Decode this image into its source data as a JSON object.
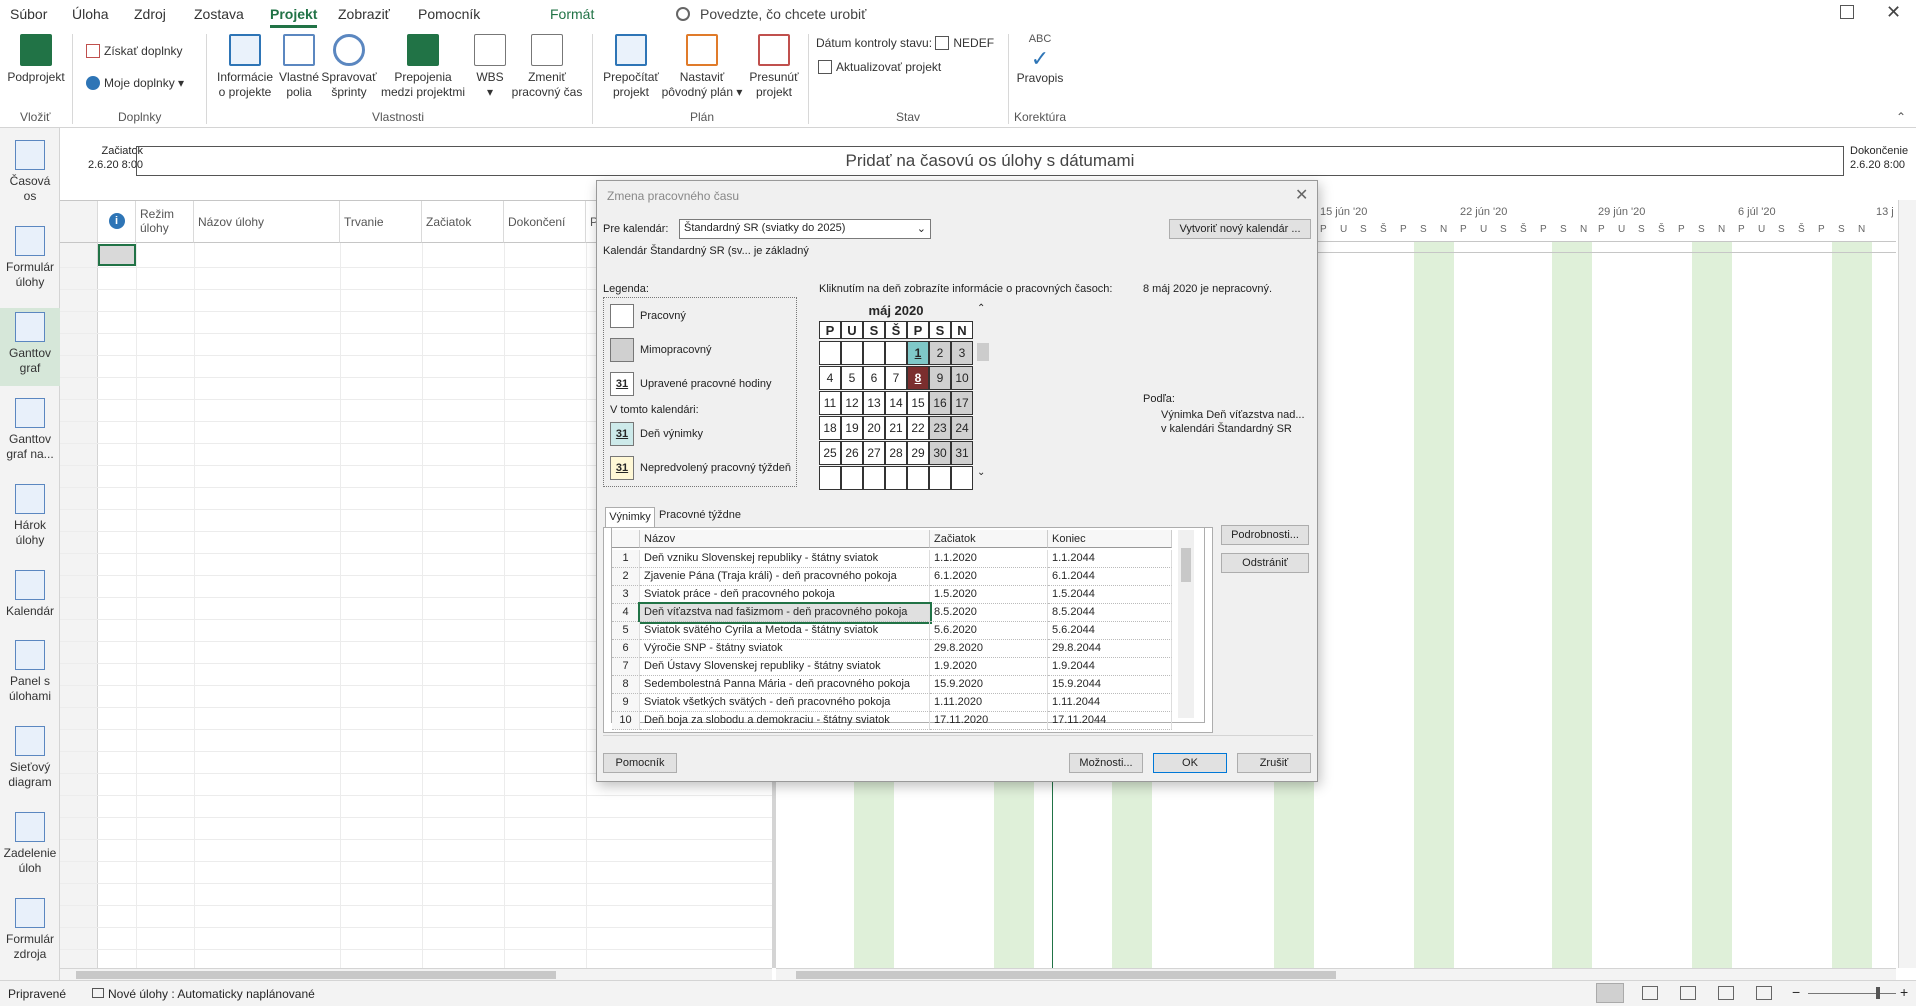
{
  "menu": {
    "items": [
      "Súbor",
      "Úloha",
      "Zdroj",
      "Zostava",
      "Projekt",
      "Zobraziť",
      "Pomocník",
      "Formát"
    ],
    "tellme": "Povedzte, čo chcete urobiť"
  },
  "ribbon": {
    "vlozit": {
      "podprojekt": "Podprojekt",
      "group": "Vložiť"
    },
    "doplnky": {
      "ziskat": "Získať doplnky",
      "moje": "Moje doplnky",
      "group": "Doplnky"
    },
    "vlastnosti": {
      "info1": "Informácie",
      "info2": "o projekte",
      "vlastne1": "Vlastné",
      "vlastne2": "polia",
      "sprav1": "Spravovať",
      "sprav2": "šprinty",
      "prep1": "Prepojenia",
      "prep2": "medzi projektmi",
      "wbs": "WBS",
      "zmen1": "Zmeniť",
      "zmen2": "pracovný čas",
      "group": "Vlastnosti"
    },
    "plan": {
      "prep1": "Prepočítať",
      "prep2": "projekt",
      "nast1": "Nastaviť",
      "nast2": "pôvodný plán",
      "pres1": "Presunúť",
      "pres2": "projekt",
      "group": "Plán"
    },
    "stav": {
      "datum_label": "Dátum kontroly stavu:",
      "datum_value": "NEDEF",
      "aktualizovat": "Aktualizovať projekt",
      "group": "Stav"
    },
    "korektura": {
      "abc": "ABC",
      "pravopis": "Pravopis",
      "group": "Korektúra"
    }
  },
  "viewbar": [
    {
      "l1": "Časová",
      "l2": "os"
    },
    {
      "l1": "Formulár",
      "l2": "úlohy"
    },
    {
      "l1": "Ganttov",
      "l2": "graf"
    },
    {
      "l1": "Ganttov",
      "l2": "graf na..."
    },
    {
      "l1": "Hárok",
      "l2": "úlohy"
    },
    {
      "l1": "Kalendár",
      "l2": ""
    },
    {
      "l1": "Panel s",
      "l2": "úlohami"
    },
    {
      "l1": "Sieťový",
      "l2": "diagram"
    },
    {
      "l1": "Zadelenie",
      "l2": "úloh"
    },
    {
      "l1": "Formulár",
      "l2": "zdroja"
    }
  ],
  "timeline": {
    "start_label": "Začiatok",
    "start_value": "2.6.20 8:00",
    "end_label": "Dokončenie",
    "end_value": "2.6.20 8:00",
    "placeholder": "Pridať na časovú os úlohy s dátumami"
  },
  "grid": {
    "info_icon": "i",
    "columns": [
      "Režim úlohy",
      "Názov úlohy",
      "Trvanie",
      "Začiatok",
      "Dokončení",
      "P"
    ]
  },
  "gantt": {
    "weeks": [
      "15 jún '20",
      "22 jún '20",
      "29 jún '20",
      "6 júl '20",
      "13 j"
    ],
    "days": [
      "P",
      "U",
      "S",
      "Š",
      "P",
      "S",
      "N"
    ]
  },
  "status": {
    "ready": "Pripravené",
    "new_tasks": "Nové úlohy : Automaticky naplánované"
  },
  "dialog": {
    "title": "Zmena pracovného času",
    "pre_kalendar_label": "Pre kalendár:",
    "pre_kalendar_value": "Štandardný SR (sviatky do 2025)",
    "base_note": "Kalendár Štandardný SR (sv... je základný",
    "new_calendar_btn": "Vytvoriť nový kalendár ...",
    "legend_title": "Legenda:",
    "legend_working": "Pracovný",
    "legend_nonworking": "Mimopracovný",
    "legend_edited": "Upravené pracovné hodiny",
    "legend_in_cal": "V tomto kalendári:",
    "legend_exception": "Deň výnimky",
    "legend_nondefault": "Nepredvolený pracovný týždeň",
    "legend_num": "31",
    "click_info": "Kliknutím na deň zobrazíte informácie o pracovných časoch:",
    "selected_info": "8 máj 2020 je nepracovný.",
    "based_on": "Podľa:",
    "based_line1": "Výnimka Deň víťazstva nad...",
    "based_line2": "v kalendári Štandardný SR",
    "month": "máj 2020",
    "dow": [
      "P",
      "U",
      "S",
      "Š",
      "P",
      "S",
      "N"
    ],
    "weeks": [
      [
        "",
        "",
        "",
        "",
        "1",
        "2",
        "3"
      ],
      [
        "4",
        "5",
        "6",
        "7",
        "8",
        "9",
        "10"
      ],
      [
        "11",
        "12",
        "13",
        "14",
        "15",
        "16",
        "17"
      ],
      [
        "18",
        "19",
        "20",
        "21",
        "22",
        "23",
        "24"
      ],
      [
        "25",
        "26",
        "27",
        "28",
        "29",
        "30",
        "31"
      ],
      [
        "",
        "",
        "",
        "",
        "",
        "",
        ""
      ]
    ],
    "tab_exceptions": "Výnimky",
    "tab_weeks": "Pracovné týždne",
    "exc_headers": [
      "Názov",
      "Začiatok",
      "Koniec"
    ],
    "exc_rows": [
      {
        "n": "1",
        "name": "Deň vzniku Slovenskej republiky - štátny sviatok",
        "start": "1.1.2020",
        "end": "1.1.2044"
      },
      {
        "n": "2",
        "name": "Zjavenie Pána (Traja králi) - deň pracovného pokoja",
        "start": "6.1.2020",
        "end": "6.1.2044"
      },
      {
        "n": "3",
        "name": "Sviatok práce - deň pracovného pokoja",
        "start": "1.5.2020",
        "end": "1.5.2044"
      },
      {
        "n": "4",
        "name": "Deň víťazstva nad fašizmom - deň pracovného pokoja",
        "start": "8.5.2020",
        "end": "8.5.2044"
      },
      {
        "n": "5",
        "name": "Sviatok svätého Cyrila a Metoda - štátny sviatok",
        "start": "5.6.2020",
        "end": "5.6.2044"
      },
      {
        "n": "6",
        "name": "Výročie SNP - štátny sviatok",
        "start": "29.8.2020",
        "end": "29.8.2044"
      },
      {
        "n": "7",
        "name": "Deň Ústavy Slovenskej republiky - štátny sviatok",
        "start": "1.9.2020",
        "end": "1.9.2044"
      },
      {
        "n": "8",
        "name": "Sedembolestná Panna Mária - deň pracovného pokoja",
        "start": "15.9.2020",
        "end": "15.9.2044"
      },
      {
        "n": "9",
        "name": "Sviatok všetkých svätých - deň pracovného pokoja",
        "start": "1.11.2020",
        "end": "1.11.2044"
      },
      {
        "n": "10",
        "name": "Deň boja za slobodu a demokraciu - štátny sviatok",
        "start": "17.11.2020",
        "end": "17.11.2044"
      }
    ],
    "details_btn": "Podrobnosti...",
    "delete_btn": "Odstrániť",
    "help_btn": "Pomocník",
    "options_btn": "Možnosti...",
    "ok_btn": "OK",
    "cancel_btn": "Zrušiť"
  },
  "colors": {
    "accent": "#217346",
    "weekend": "#dff0d9",
    "exception_day": "#7fc8c8",
    "selected_day": "#7b2e2e"
  }
}
